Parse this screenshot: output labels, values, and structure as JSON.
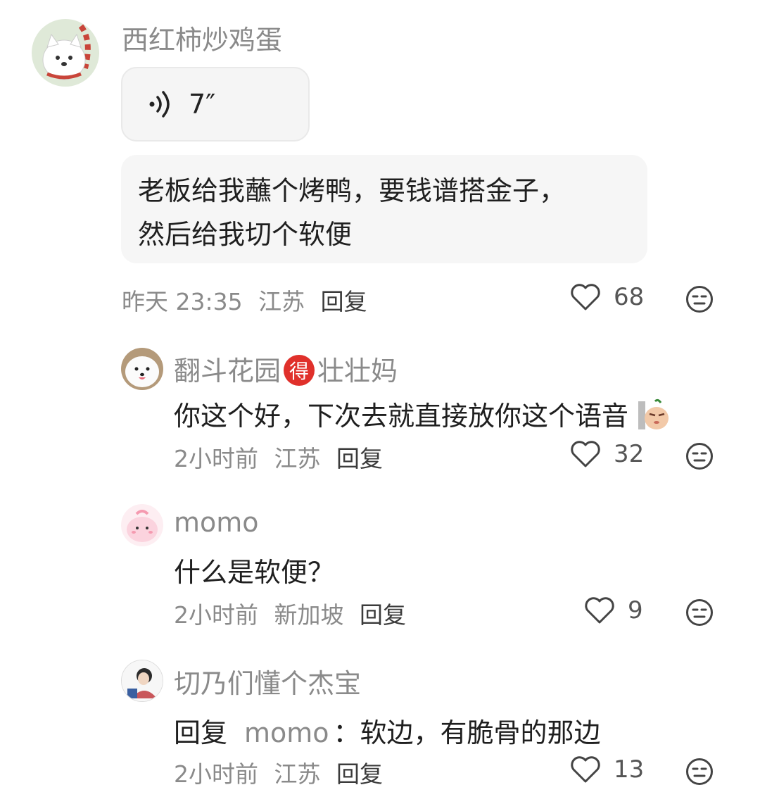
{
  "comments": [
    {
      "author": "西红柿炒鸡蛋",
      "voice_duration": "7″",
      "transcript": [
        "老板给我蘸个烤鸭，要钱谱搭金子，",
        "然后给我切个软便"
      ],
      "time": "昨天 23:35",
      "location": "江苏",
      "reply_label": "回复",
      "likes": "68"
    },
    {
      "author_part1": "翻斗花园",
      "badge": "得",
      "author_part2": "壮壮妈",
      "text": "你这个好，下次去就直接放你这个语音",
      "time": "2小时前",
      "location": "江苏",
      "reply_label": "回复",
      "likes": "32"
    },
    {
      "author": "momo",
      "text": "什么是软便？",
      "time": "2小时前",
      "location": "新加坡",
      "reply_label": "回复",
      "likes": "9"
    },
    {
      "author": "切乃们懂个杰宝",
      "reply_prefix": "回复",
      "reply_to": "momo",
      "text": "：软边，有脆骨的那边",
      "time": "2小时前",
      "location": "江苏",
      "reply_label": "回复",
      "likes": "13"
    }
  ],
  "icons": {
    "like": "heart-outline-icon",
    "dislike": "meh-face-icon",
    "voice": "sound-wave-icon"
  },
  "colors": {
    "secondary_text": "#8a8a8a",
    "badge_red": "#e0302b",
    "bubble_bg": "#f6f6f6"
  }
}
